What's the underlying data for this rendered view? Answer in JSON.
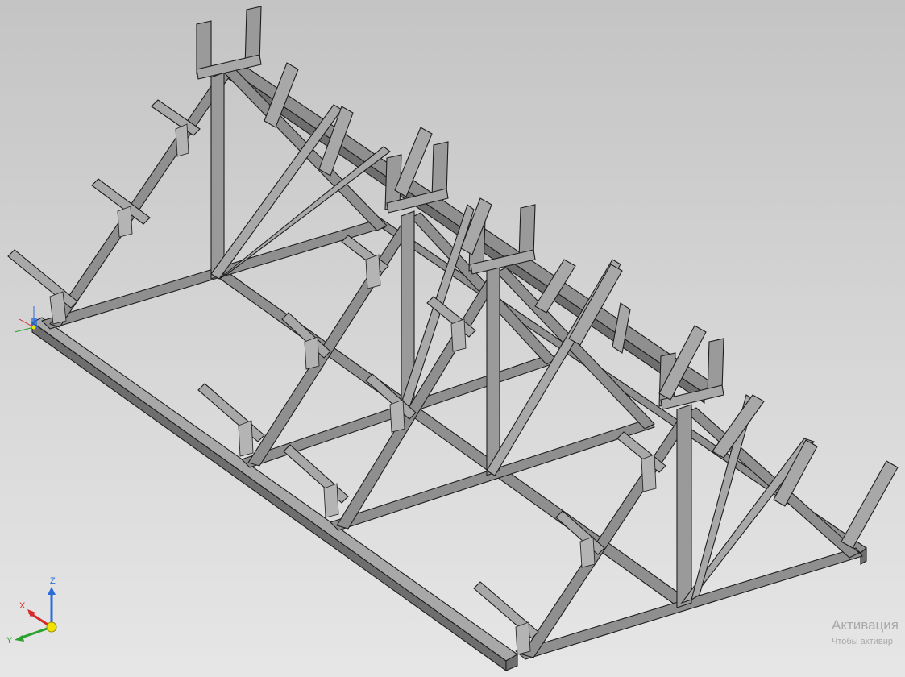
{
  "viewport": {
    "background_top": "#c4c4c4",
    "background_bottom": "#e6e6e6",
    "model": "steel roof truss frame",
    "trusses": 4,
    "purlin_rows_per_slope": 3
  },
  "axis_triad": {
    "x_label": "X",
    "y_label": "Y",
    "z_label": "Z",
    "x_color": "#d62828",
    "y_color": "#2ca02c",
    "z_color": "#2b6cd9",
    "origin_color": "#f2e200"
  },
  "origin_marker": {
    "icon": "local-origin-icon"
  },
  "watermark": {
    "title": "Активация",
    "subtitle": "Чтобы активир"
  }
}
